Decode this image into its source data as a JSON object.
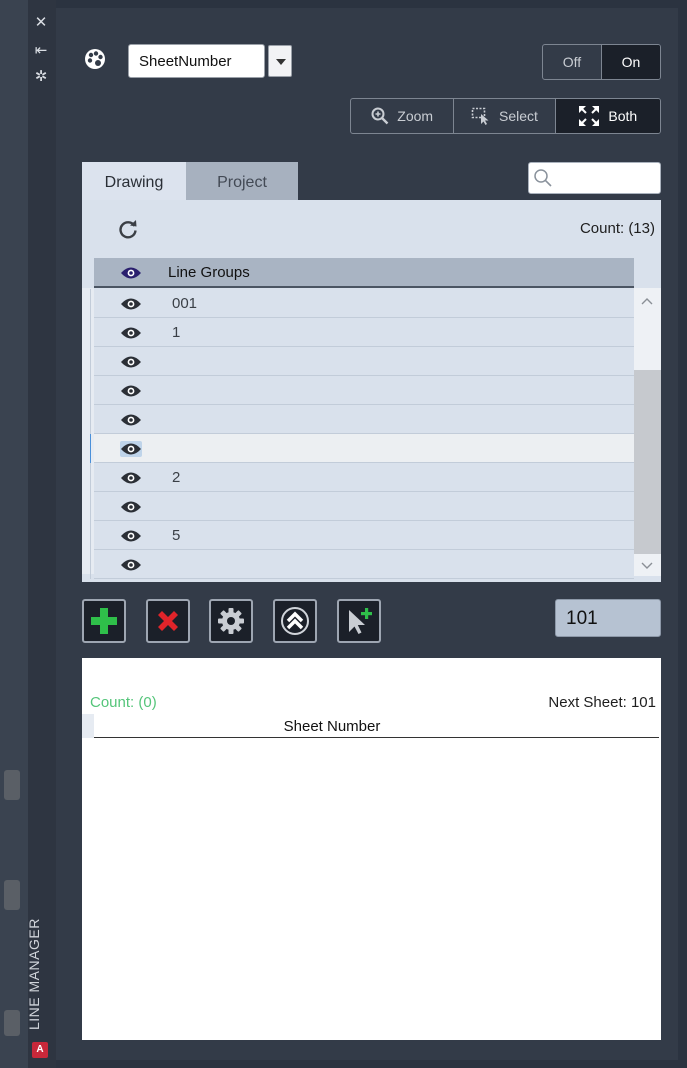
{
  "sidebar": {
    "icons": [
      "close-icon",
      "pin-icon",
      "settings-icon"
    ],
    "title": "LINE MANAGER",
    "app_badge": "A"
  },
  "toolbar_top": {
    "style_select_value": "SheetNumber",
    "toggle": {
      "off_label": "Off",
      "on_label": "On",
      "active": "On"
    },
    "zoom_modes": [
      {
        "label": "Zoom",
        "icon": "zoom-icon"
      },
      {
        "label": "Select",
        "icon": "select-icon"
      },
      {
        "label": "Both",
        "icon": "fit-icon"
      }
    ],
    "active_zoom_mode": "Both"
  },
  "tabs": [
    {
      "label": "Drawing",
      "active": true
    },
    {
      "label": "Project",
      "active": false
    }
  ],
  "search": {
    "placeholder": ""
  },
  "groups_list": {
    "count_label": "Count: (13)",
    "column_header": "Line Groups",
    "rows": [
      {
        "value": "001",
        "selected": false
      },
      {
        "value": "1",
        "selected": false
      },
      {
        "value": "",
        "selected": false
      },
      {
        "value": "",
        "selected": false
      },
      {
        "value": "",
        "selected": false
      },
      {
        "value": "",
        "selected": true
      },
      {
        "value": "2",
        "selected": false
      },
      {
        "value": "",
        "selected": false
      },
      {
        "value": "5",
        "selected": false
      },
      {
        "value": "",
        "selected": false
      }
    ]
  },
  "actions": {
    "buttons": [
      "add-icon",
      "delete-icon",
      "settings-icon",
      "move-up-icon",
      "pick-icon"
    ],
    "number_value": "101"
  },
  "sheet_list": {
    "count_label": "Count: (0)",
    "next_sheet_label": "Next Sheet: 101",
    "column_header": "Sheet Number"
  },
  "colors": {
    "panel": "#333b48",
    "list_bg": "#d9e1ec",
    "header_bg": "#a9b4c3",
    "eye": "#2b2f36",
    "eye_header": "#2a1f6e",
    "add_green": "#2fbf4a",
    "delete_red": "#e0242a",
    "count_green": "#55c57a"
  }
}
